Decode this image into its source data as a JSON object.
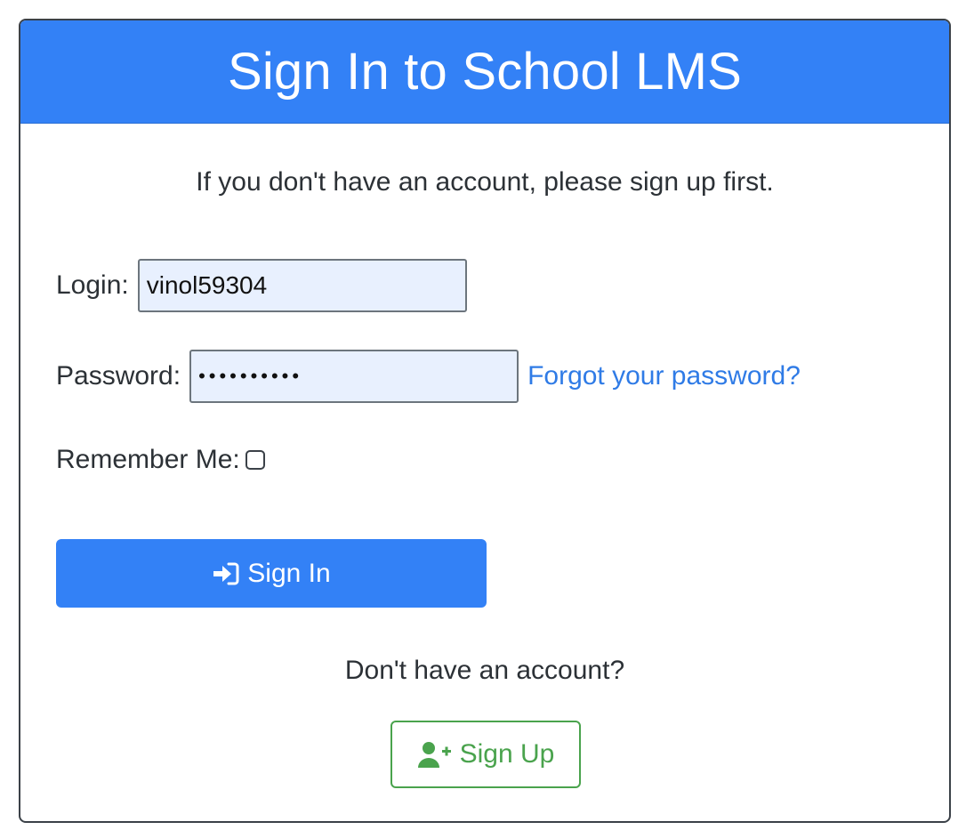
{
  "header": {
    "title": "Sign In to School LMS"
  },
  "intro_text": "If you don't have an account, please sign up first.",
  "form": {
    "login_label": "Login:",
    "login_value": "vinol59304",
    "password_label": "Password:",
    "password_value": "••••••••••",
    "forgot_link": "Forgot your password?",
    "remember_label": "Remember Me:",
    "remember_checked": false,
    "signin_button": "Sign In",
    "signin_icon": "sign-in-icon"
  },
  "signup": {
    "prompt": "Don't have an account?",
    "button": "Sign Up",
    "icon": "user-plus-icon"
  },
  "colors": {
    "primary": "#3381f6",
    "success": "#4aa34d",
    "link": "#2f7be6"
  }
}
